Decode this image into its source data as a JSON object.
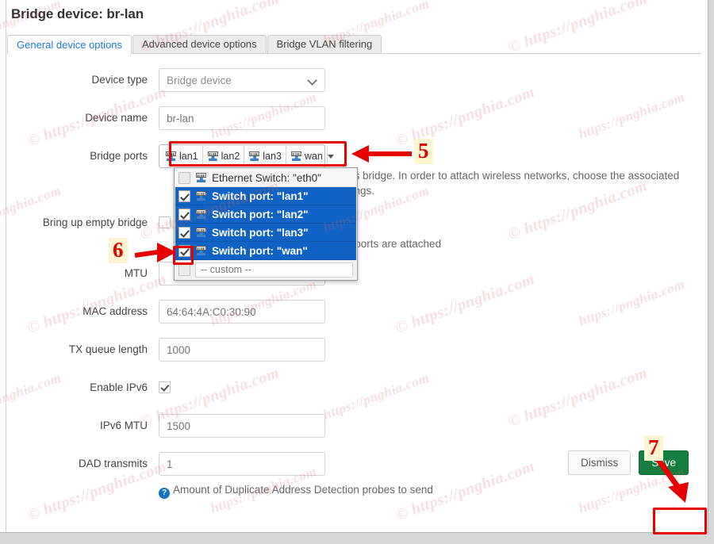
{
  "window": {
    "title": "Bridge device: br-lan"
  },
  "tabs": [
    {
      "label": "General device options",
      "active": true
    },
    {
      "label": "Advanced device options",
      "active": false
    },
    {
      "label": "Bridge VLAN filtering",
      "active": false
    }
  ],
  "form": {
    "device_type": {
      "label": "Device type",
      "value": "Bridge device"
    },
    "device_name": {
      "label": "Device name",
      "value": "br-lan",
      "placeholder": "br-lan"
    },
    "bridge_ports": {
      "label": "Bridge ports",
      "tags": [
        "lan1",
        "lan2",
        "lan3",
        "wan"
      ],
      "help": "his bridge. In order to attach wireless networks, choose the associated",
      "help2": "ttings."
    },
    "bring_up_empty_bridge": {
      "label": "Bring up empty bridge",
      "help": "o ports are attached",
      "checked": false
    },
    "mtu": {
      "label": "MTU",
      "value": ""
    },
    "mac_address": {
      "label": "MAC address",
      "value": "64:64:4A:C0:30:90"
    },
    "tx_queue_length": {
      "label": "TX queue length",
      "value": "1000"
    },
    "enable_ipv6": {
      "label": "Enable IPv6",
      "checked": true
    },
    "ipv6_mtu": {
      "label": "IPv6 MTU",
      "value": "1500"
    },
    "dad_transmits": {
      "label": "DAD transmits",
      "value": "1",
      "help": "Amount of Duplicate Address Detection probes to send"
    }
  },
  "dropdown": {
    "items": [
      {
        "label": "Ethernet Switch: \"eth0\"",
        "checked": false,
        "selected": false
      },
      {
        "label": "Switch port: \"lan1\"",
        "checked": true,
        "selected": true
      },
      {
        "label": "Switch port: \"lan2\"",
        "checked": true,
        "selected": true
      },
      {
        "label": "Switch port: \"lan3\"",
        "checked": true,
        "selected": true
      },
      {
        "label": "Switch port: \"wan\"",
        "checked": true,
        "selected": true
      }
    ],
    "custom_placeholder": "-- custom --"
  },
  "footer": {
    "dismiss_label": "Dismiss",
    "save_label": "Save"
  },
  "annotations": {
    "step5": "5",
    "step6": "6",
    "step7": "7",
    "color": "#e60000",
    "highlight_bg": "#fdf5cf"
  },
  "watermark": {
    "text_a": "© https://pnghia.com",
    "text_b": "https://pnghia.com",
    "color": "#e25c5f"
  }
}
